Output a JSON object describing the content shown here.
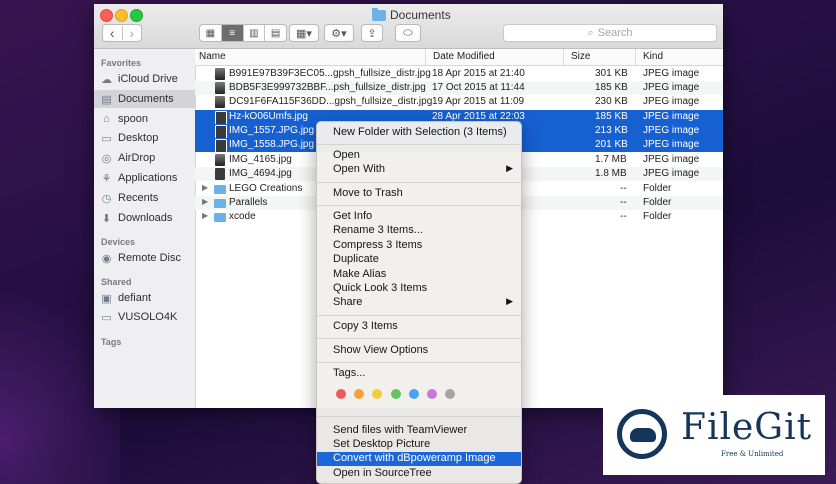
{
  "window": {
    "title": "Documents"
  },
  "toolbar": {
    "back": "‹",
    "forward": "›",
    "view_icons": "▦",
    "view_list": "≡",
    "view_columns": "▥",
    "view_cover": "▤",
    "arrange": "▦▾",
    "action": "⚙▾",
    "share": "⇪",
    "tag": "⬭",
    "search_placeholder": "Search"
  },
  "sidebar": {
    "favorites_header": "Favorites",
    "favorites": [
      {
        "label": "iCloud Drive",
        "icon": "cloud-icon"
      },
      {
        "label": "Documents",
        "icon": "document-icon",
        "selected": true
      },
      {
        "label": "spoon",
        "icon": "home-icon"
      },
      {
        "label": "Desktop",
        "icon": "desktop-icon"
      },
      {
        "label": "AirDrop",
        "icon": "airdrop-icon"
      },
      {
        "label": "Applications",
        "icon": "applications-icon"
      },
      {
        "label": "Recents",
        "icon": "clock-icon"
      },
      {
        "label": "Downloads",
        "icon": "download-icon"
      }
    ],
    "devices_header": "Devices",
    "devices": [
      {
        "label": "Remote Disc",
        "icon": "disc-icon"
      }
    ],
    "shared_header": "Shared",
    "shared": [
      {
        "label": "defiant",
        "icon": "computer-icon"
      },
      {
        "label": "VUSOLO4K",
        "icon": "monitor-icon"
      }
    ],
    "tags_header": "Tags"
  },
  "columns": {
    "name": "Name",
    "date": "Date Modified",
    "size": "Size",
    "kind": "Kind"
  },
  "files": [
    {
      "name": "B991E97B39F3EC05...gpsh_fullsize_distr.jpg",
      "date": "18 Apr 2015 at 21:40",
      "size": "301 KB",
      "kind": "JPEG image",
      "type": "img"
    },
    {
      "name": "BDB5F3E999732BBF...psh_fullsize_distr.jpg",
      "date": "17 Oct 2015 at 11:44",
      "size": "185 KB",
      "kind": "JPEG image",
      "type": "img"
    },
    {
      "name": "DC91F6FA115F36DD...gpsh_fullsize_distr.jpg",
      "date": "19 Apr 2015 at 11:09",
      "size": "230 KB",
      "kind": "JPEG image",
      "type": "img"
    },
    {
      "name": "Hz-kO06Umfs.jpg",
      "date": "28 Apr 2015 at 22:03",
      "size": "185 KB",
      "kind": "JPEG image",
      "type": "img",
      "selected": true
    },
    {
      "name": "IMG_1557.JPG.jpg",
      "date": "",
      "size": "213 KB",
      "kind": "JPEG image",
      "type": "img",
      "selected": true
    },
    {
      "name": "IMG_1558.JPG.jpg",
      "date": "",
      "size": "201 KB",
      "kind": "JPEG image",
      "type": "img",
      "selected": true
    },
    {
      "name": "IMG_4165.jpg",
      "date": "",
      "size": "1.7 MB",
      "kind": "JPEG image",
      "type": "img"
    },
    {
      "name": "IMG_4694.jpg",
      "date": "",
      "size": "1.8 MB",
      "kind": "JPEG image",
      "type": "img"
    },
    {
      "name": "LEGO Creations",
      "date": "",
      "size": "--",
      "kind": "Folder",
      "type": "folder"
    },
    {
      "name": "Parallels",
      "date": "",
      "size": "--",
      "kind": "Folder",
      "type": "folder"
    },
    {
      "name": "xcode",
      "date": "",
      "size": "--",
      "kind": "Folder",
      "type": "folder"
    }
  ],
  "context_menu": {
    "group1": [
      "New Folder with Selection (3 Items)"
    ],
    "group2": [
      {
        "label": "Open"
      },
      {
        "label": "Open With",
        "submenu": true
      }
    ],
    "group3": [
      "Move to Trash"
    ],
    "group4": [
      {
        "label": "Get Info"
      },
      {
        "label": "Rename 3 Items..."
      },
      {
        "label": "Compress 3 Items"
      },
      {
        "label": "Duplicate"
      },
      {
        "label": "Make Alias"
      },
      {
        "label": "Quick Look 3 Items"
      },
      {
        "label": "Share",
        "submenu": true
      }
    ],
    "group5": [
      "Copy 3 Items"
    ],
    "group6": [
      "Show View Options"
    ],
    "tags_label": "Tags...",
    "tag_colors": [
      "#f0595a",
      "#f6a13c",
      "#f4cc3d",
      "#63c55a",
      "#4aa3f0",
      "#c37ad9",
      "#a5a5a5"
    ],
    "services": [
      "Send files with TeamViewer",
      "Set Desktop Picture",
      "Convert with dBpoweramp Image",
      "Open in SourceTree"
    ],
    "highlighted": "Convert with dBpoweramp Image",
    "submenu_arrow": "▶"
  },
  "watermark": {
    "name": "FileGit",
    "tagline": "Free & Unlimited"
  }
}
